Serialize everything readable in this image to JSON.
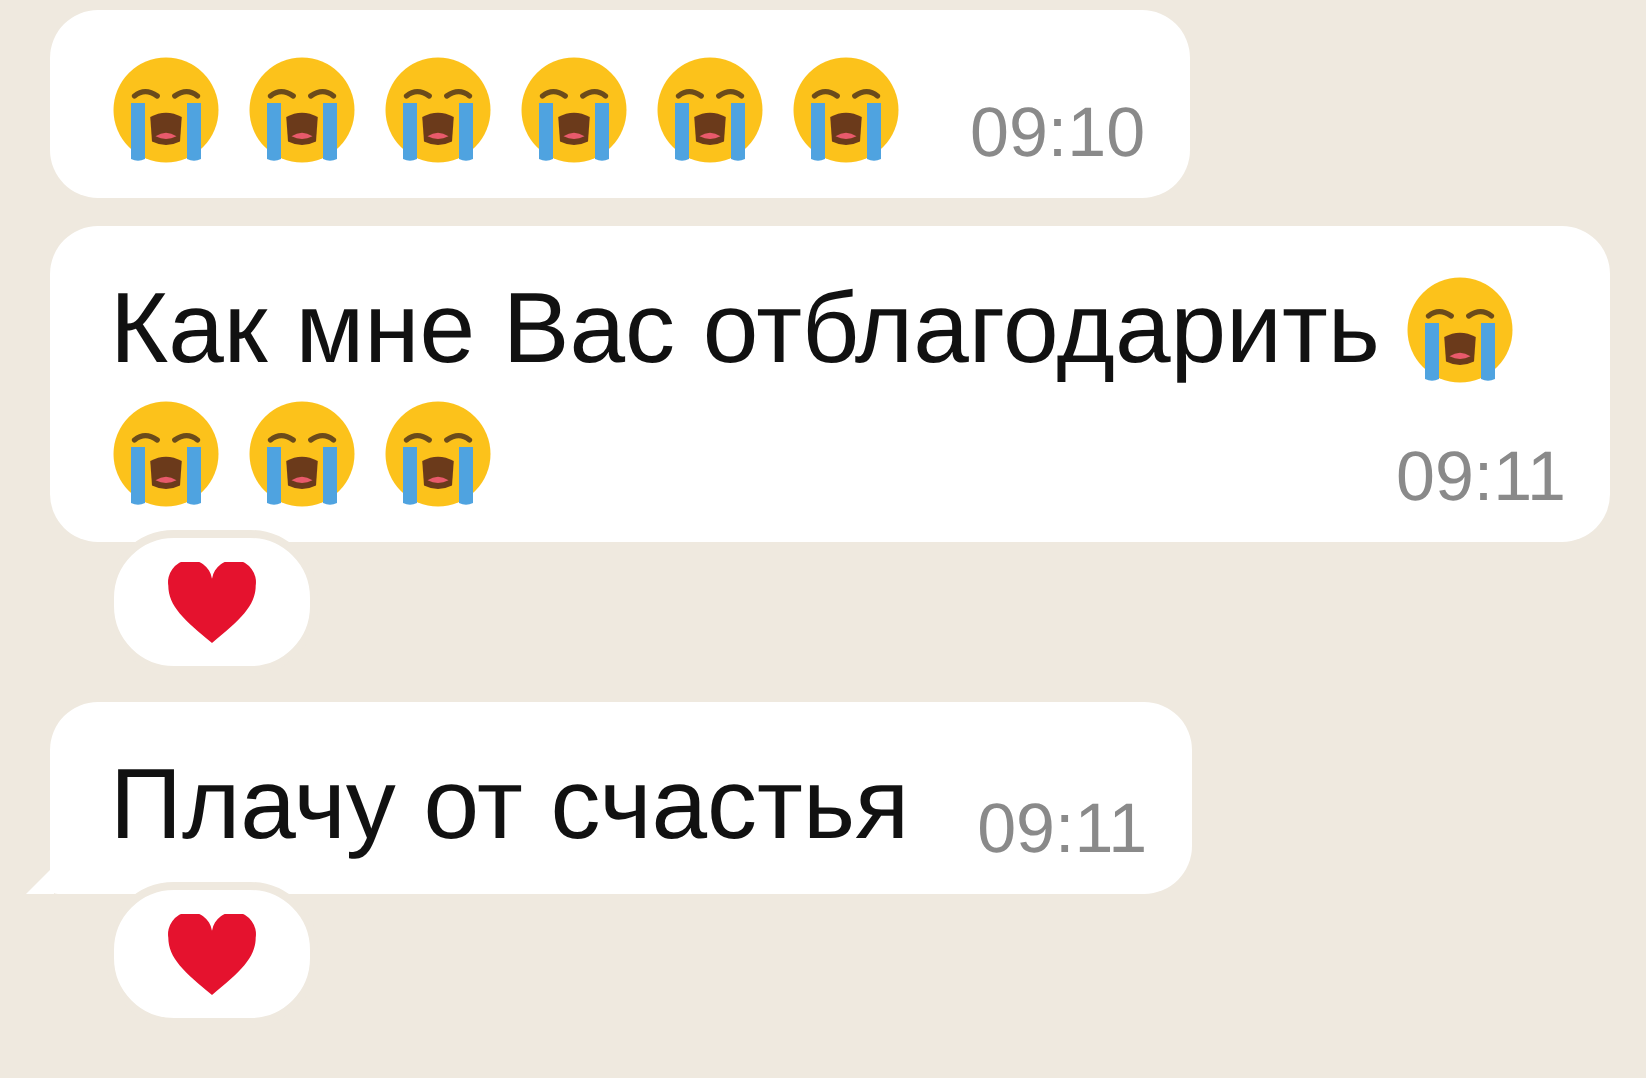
{
  "messages": [
    {
      "parts": [
        {
          "kind": "crying-emoji"
        },
        {
          "kind": "crying-emoji"
        },
        {
          "kind": "crying-emoji"
        },
        {
          "kind": "crying-emoji"
        },
        {
          "kind": "crying-emoji"
        },
        {
          "kind": "crying-emoji"
        }
      ],
      "time": "09:10",
      "tail": false
    },
    {
      "parts": [
        {
          "kind": "text",
          "text": "Как мне Вас отблагодарить"
        },
        {
          "kind": "crying-emoji"
        },
        {
          "kind": "crying-emoji"
        },
        {
          "kind": "crying-emoji"
        },
        {
          "kind": "crying-emoji"
        }
      ],
      "time": "09:11",
      "tail": false,
      "reaction": {
        "kind": "heart"
      }
    },
    {
      "parts": [
        {
          "kind": "text",
          "text": "Плачу от счастья"
        }
      ],
      "time": "09:11",
      "tail": true,
      "reaction": {
        "kind": "heart"
      }
    }
  ]
}
